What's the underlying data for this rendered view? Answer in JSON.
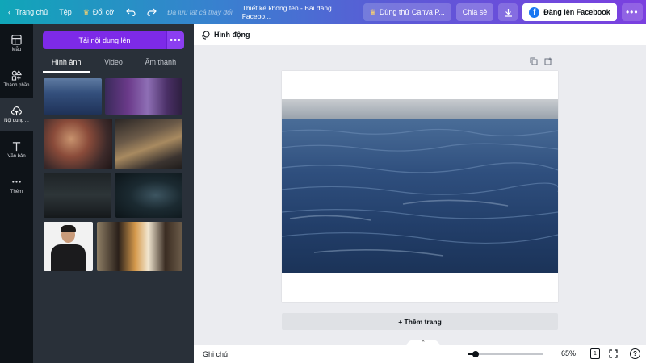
{
  "topbar": {
    "home_label": "Trang chủ",
    "file_label": "Tệp",
    "resize_label": "Đổi cỡ",
    "saved_text": "Đã lưu tất cả thay đổi",
    "doc_title": "Thiết kế không tên - Bài đăng Facebo...",
    "try_pro_label": "Dùng thử Canva P...",
    "share_label": "Chia sẻ",
    "post_fb_label": "Đăng lên Facebook",
    "more_label": "•••"
  },
  "rail": {
    "items": [
      {
        "label": "Mẫu",
        "icon": "template-icon"
      },
      {
        "label": "Thành phần",
        "icon": "elements-icon"
      },
      {
        "label": "Nội dung ...",
        "icon": "upload-cloud-icon"
      },
      {
        "label": "Văn bản",
        "icon": "text-icon"
      },
      {
        "label": "Thêm",
        "icon": "more-icon"
      }
    ]
  },
  "panel": {
    "upload_label": "Tải nội dung lên",
    "upload_more": "•••",
    "tabs": [
      "Hình ảnh",
      "Video",
      "Âm thanh"
    ],
    "collapse_glyph": "‹"
  },
  "main": {
    "animate_label": "Hình động",
    "add_page_label": "+ Thêm trang",
    "up_glyph": "⌃"
  },
  "bottombar": {
    "notes_label": "Ghi chú",
    "zoom_value": "65%",
    "zoom_fraction": 0.1,
    "page_count": "1",
    "help_label": "?"
  },
  "colors": {
    "accent": "#7d2ae8",
    "panel_bg": "#293039",
    "rail_bg": "#0e1318",
    "facebook": "#1877f2"
  }
}
